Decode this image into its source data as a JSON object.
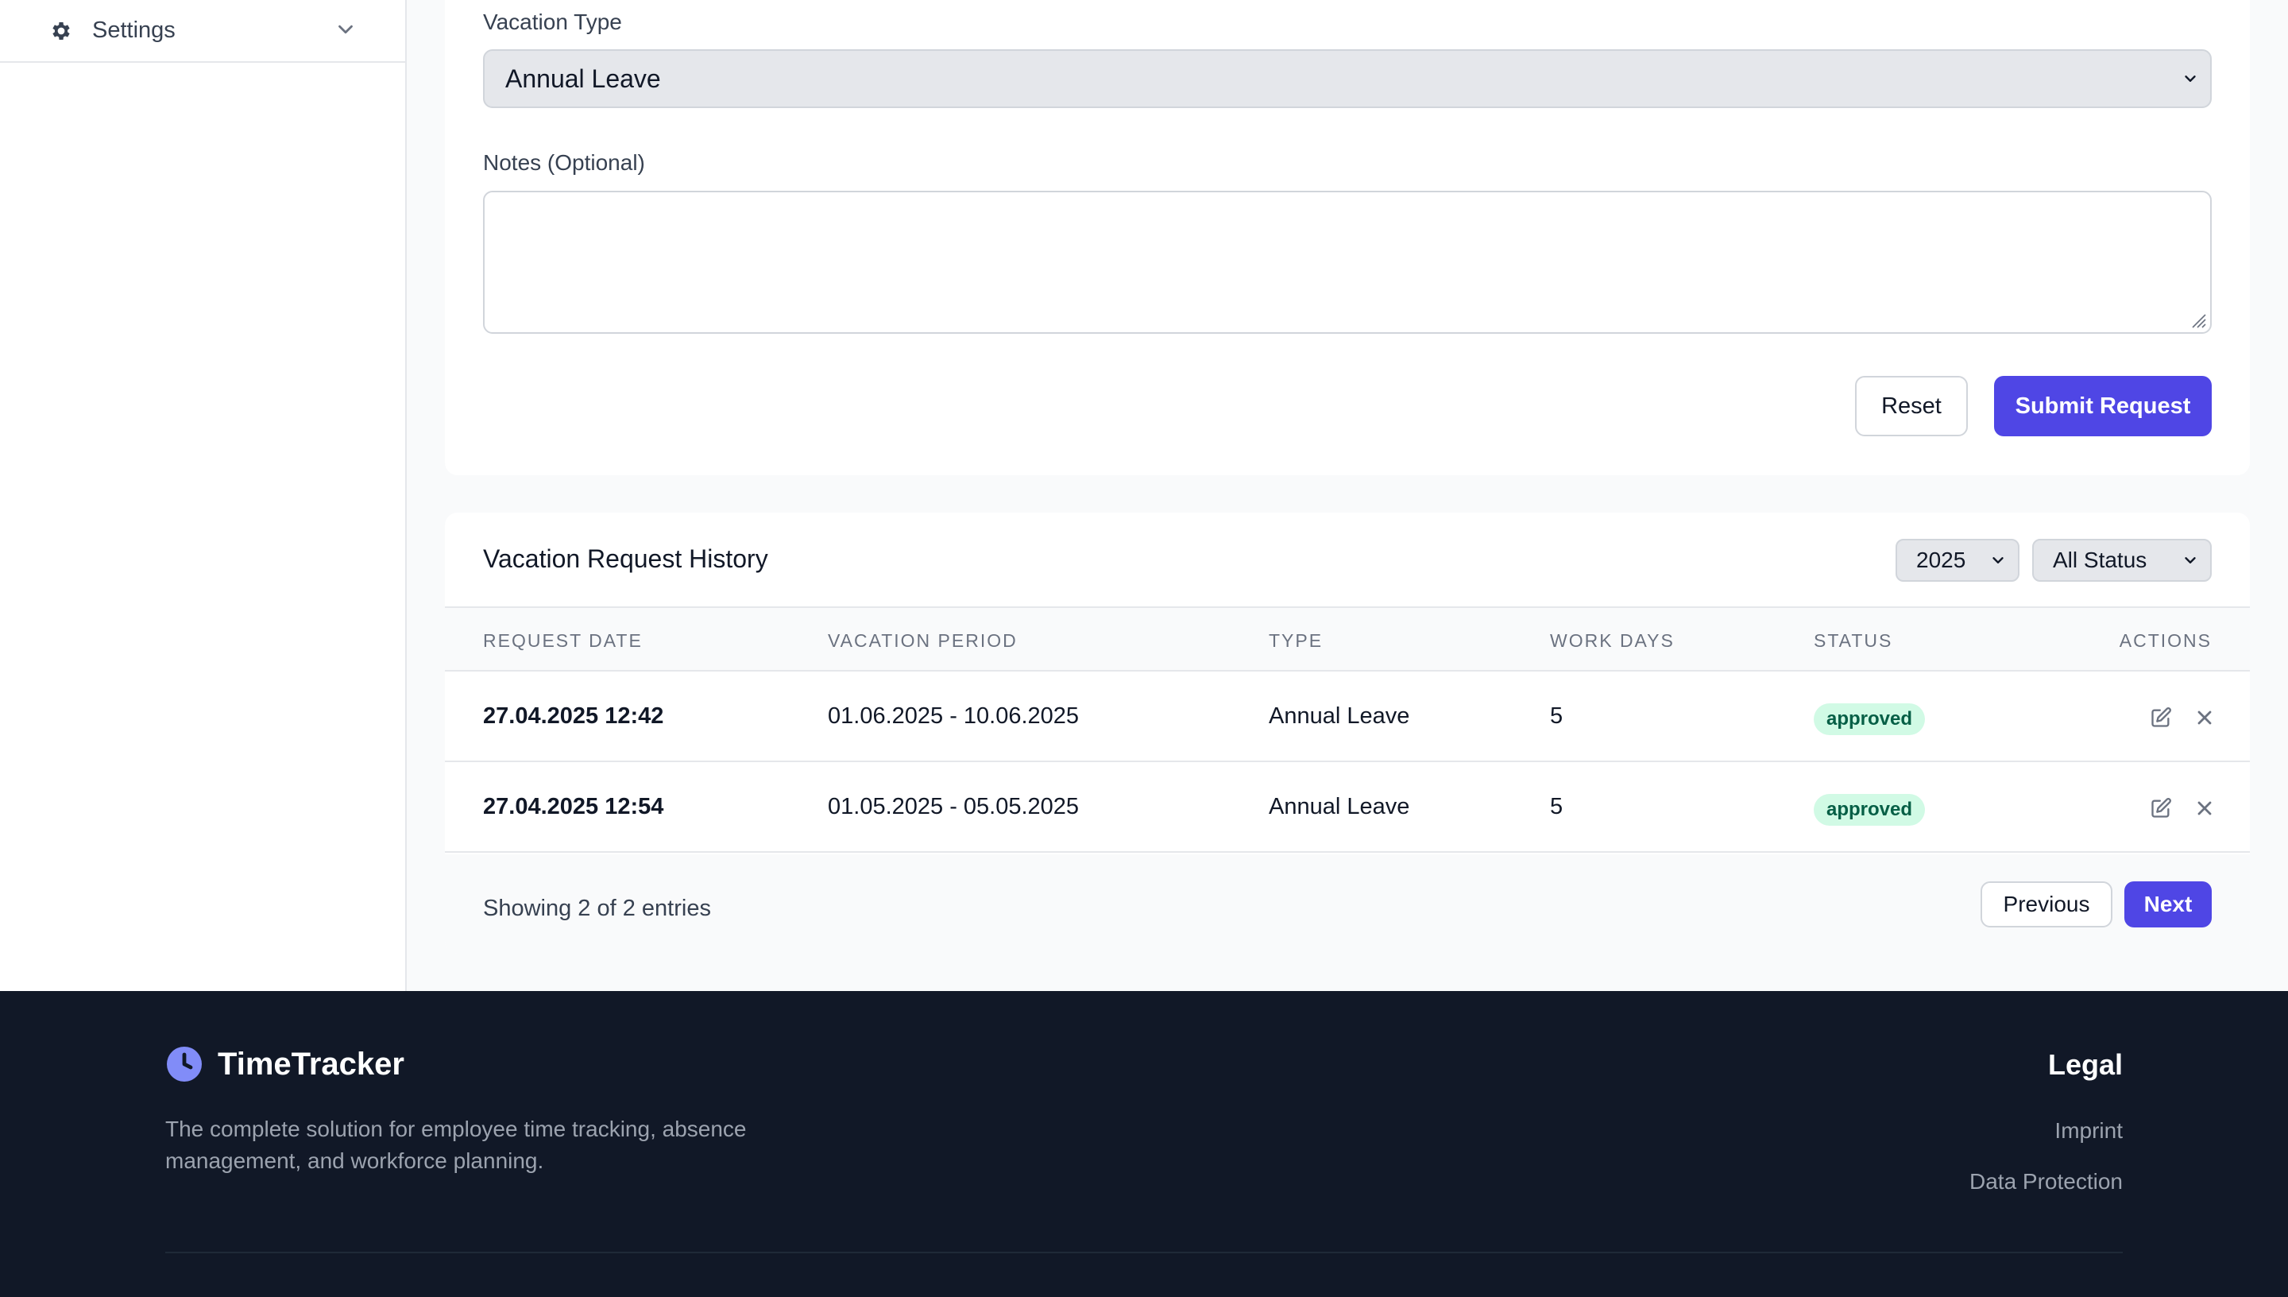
{
  "sidebar": {
    "settings": {
      "label": "Settings",
      "icon": "gear-icon",
      "chevron": "chevron-down-icon"
    }
  },
  "form": {
    "vacation_type_label": "Vacation Type",
    "vacation_type_value": "Annual Leave",
    "notes_label": "Notes (Optional)",
    "notes_value": "",
    "reset_label": "Reset",
    "submit_label": "Submit Request"
  },
  "history": {
    "title": "Vacation Request History",
    "year_filter": "2025",
    "status_filter": "All Status",
    "columns": [
      "REQUEST DATE",
      "VACATION PERIOD",
      "TYPE",
      "WORK DAYS",
      "STATUS",
      "ACTIONS"
    ],
    "rows": [
      {
        "request_date": "27.04.2025 12:42",
        "period": "01.06.2025 - 10.06.2025",
        "type": "Annual Leave",
        "work_days": "5",
        "status": "approved"
      },
      {
        "request_date": "27.04.2025 12:54",
        "period": "01.05.2025 - 05.05.2025",
        "type": "Annual Leave",
        "work_days": "5",
        "status": "approved"
      }
    ],
    "showing_text": "Showing 2 of 2 entries",
    "previous_label": "Previous",
    "next_label": "Next"
  },
  "footer": {
    "brand_name": "TimeTracker",
    "tagline": "The complete solution for employee time tracking, absence management, and workforce planning.",
    "legal_title": "Legal",
    "legal_links": [
      "Imprint",
      "Data Protection"
    ]
  },
  "colors": {
    "primary": "#4f46e5",
    "footer_bg": "#111827",
    "badge_bg": "#d1fae5",
    "badge_text": "#065f46",
    "brand_icon": "#818cf8"
  }
}
